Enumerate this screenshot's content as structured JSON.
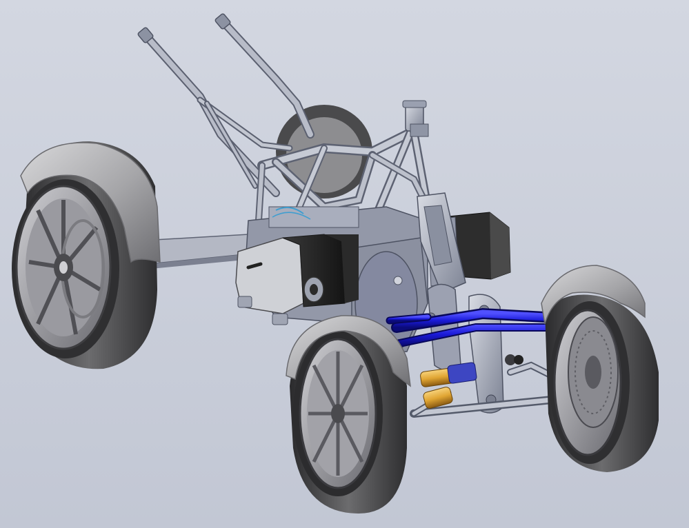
{
  "viewport": {
    "background_top": "#d3d7e1",
    "background_bottom": "#c2c7d4"
  },
  "model": {
    "colors": {
      "steel": "#a3a9b9",
      "steel_light": "#d4d8e1",
      "steel_dark": "#656b7c",
      "tire": "#3e3e40",
      "tire_light": "#7a7a7c",
      "fender": "#a8a8ab",
      "fender_light": "#dcdcde",
      "battery": "#242424",
      "arm_blue": "#1a1ad8",
      "arm_blue_dark": "#0b0b7a",
      "shock_gold": "#e0a533",
      "shock_blue": "#3d46c2"
    }
  }
}
